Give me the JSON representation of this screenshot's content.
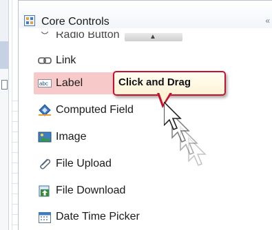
{
  "palette": {
    "header": "Core Controls",
    "items": [
      {
        "label": "Radio Button",
        "icon": "radio-button-icon"
      },
      {
        "label": "Link",
        "icon": "link-icon"
      },
      {
        "label": "Label",
        "icon": "label-icon"
      },
      {
        "label": "Computed Field",
        "icon": "computed-field-icon"
      },
      {
        "label": "Image",
        "icon": "image-icon"
      },
      {
        "label": "File Upload",
        "icon": "file-upload-icon"
      },
      {
        "label": "File Download",
        "icon": "file-download-icon"
      },
      {
        "label": "Date Time Picker",
        "icon": "date-time-picker-icon"
      }
    ]
  },
  "tooltip": {
    "text": "Click and Drag"
  },
  "colors": {
    "highlight": "#f7c9c9",
    "tooltip_border": "#c8102e",
    "tooltip_fill": "#fff3d6"
  }
}
